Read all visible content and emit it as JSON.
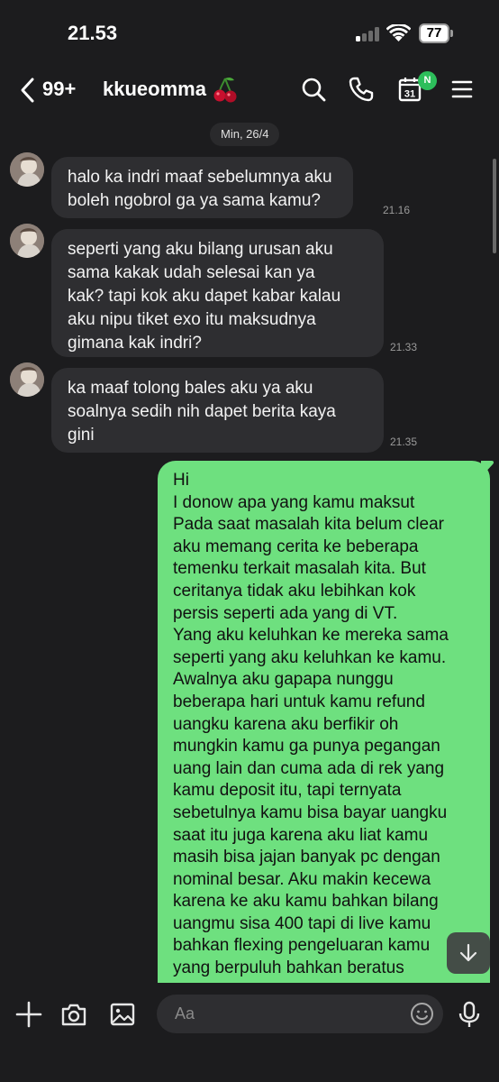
{
  "status_bar": {
    "time": "21.53",
    "battery": "77"
  },
  "header": {
    "unread_count": "99+",
    "chat_name": "kkueomma",
    "calendar_day": "31",
    "calendar_badge": "N"
  },
  "chat": {
    "date_label": "Min, 26/4",
    "incoming": [
      {
        "lines": [
          "halo ka indri maaf sebelumnya aku",
          "boleh ngobrol ga ya sama kamu?"
        ],
        "time": "21.16"
      },
      {
        "lines": [
          "seperti yang aku bilang urusan aku",
          "sama kakak udah selesai kan ya",
          "kak? tapi kok aku dapet kabar kalau",
          "aku nipu tiket exo itu maksudnya",
          "gimana kak indri?"
        ],
        "time": "21.33"
      },
      {
        "lines": [
          "ka maaf tolong bales aku ya aku",
          "soalnya sedih nih dapet berita kaya",
          "gini"
        ],
        "time": "21.35"
      }
    ],
    "outgoing_text": "Hi\nI donow apa yang kamu maksut\nPada saat masalah kita belum clear\naku memang cerita ke beberapa\ntemenku terkait masalah kita. But\nceritanya tidak aku lebihkan kok\npersis seperti ada yang di VT.\nYang aku keluhkan ke mereka sama\nseperti yang aku keluhkan ke kamu.\nAwalnya aku gapapa nunggu\nbeberapa hari untuk kamu refund\nuangku karena aku berfikir oh\nmungkin kamu ga punya pegangan\nuang lain dan cuma ada di rek yang\nkamu deposit itu, tapi ternyata\nsebetulnya kamu bisa bayar uangku\nsaat itu juga karena aku liat kamu\nmasih bisa jajan banyak pc dengan\nnominal besar. Aku makin kecewa\nkarena ke aku kamu bahkan bilang\nuangmu sisa 400 tapi di live kamu\nbahkan flexing pengeluaran kamu\nyang berpuluh bahkan beratus"
  },
  "composer": {
    "placeholder": "Aa"
  },
  "colors": {
    "background": "#1c1c1e",
    "incoming_bubble": "#2e2e31",
    "outgoing_bubble": "#6ee07f",
    "badge_green": "#2dbe5b"
  },
  "icons": [
    "back-icon",
    "cherry-icon",
    "search-icon",
    "call-icon",
    "calendar-icon",
    "menu-icon",
    "plus-icon",
    "camera-icon",
    "image-icon",
    "emoji-icon",
    "mic-icon",
    "arrow-down-icon"
  ]
}
